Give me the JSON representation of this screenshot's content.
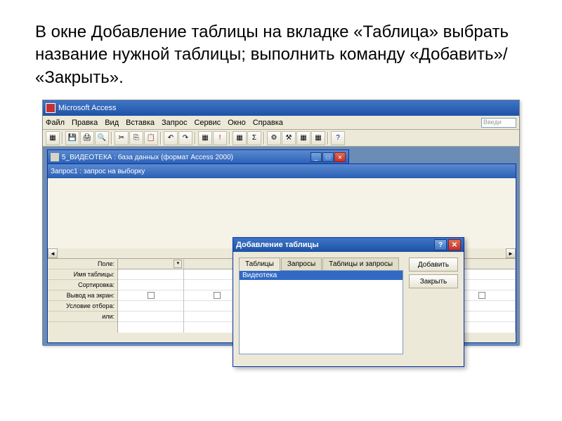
{
  "slide_text": "В окне Добавление таблицы на вкладке «Таблица» выбрать название нужной таблицы; выполнить команду «Добавить»/ «Закрыть».",
  "app_title": "Microsoft Access",
  "menubar": [
    "Файл",
    "Правка",
    "Вид",
    "Вставка",
    "Запрос",
    "Сервис",
    "Окно",
    "Справка"
  ],
  "search_placeholder": "Введи",
  "db_window_title": "5_ВИДЕОТЕКА : база данных (формат Access 2000)",
  "query_window_title": "Запрос1 : запрос на выборку",
  "grid_labels": [
    "Поле:",
    "Имя таблицы:",
    "Сортировка:",
    "Вывод на экран:",
    "Условие отбора:",
    "или:"
  ],
  "dialog": {
    "title": "Добавление таблицы",
    "tabs": [
      "Таблицы",
      "Запросы",
      "Таблицы и запросы"
    ],
    "list_item": "Видеотека",
    "btn_add": "Добавить",
    "btn_close": "Закрыть"
  }
}
